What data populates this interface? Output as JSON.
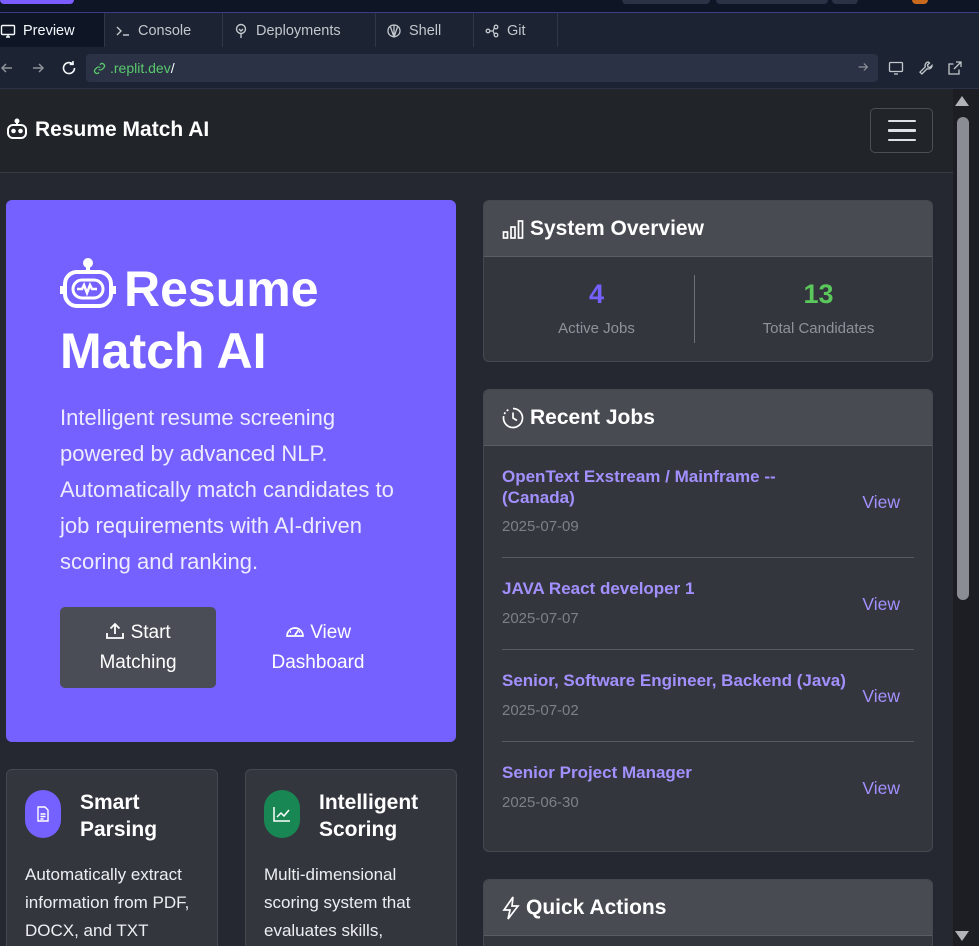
{
  "tabs": [
    {
      "label": "Preview",
      "icon": "monitor-icon"
    },
    {
      "label": "Console",
      "icon": "terminal-icon"
    },
    {
      "label": "Deployments",
      "icon": "deploy-icon"
    },
    {
      "label": "Shell",
      "icon": "shell-icon"
    },
    {
      "label": "Git",
      "icon": "git-icon"
    }
  ],
  "url": {
    "host": ".replit.dev",
    "path": "/"
  },
  "navbar": {
    "brand": "Resume Match AI"
  },
  "hero": {
    "title": "Resume Match AI",
    "description": "Intelligent resume screening powered by advanced NLP. Automatically match candidates to job requirements with AI-driven scoring and ranking.",
    "start_line1": "Start",
    "start_line2": "Matching",
    "dash_line1": "View",
    "dash_line2": "Dashboard"
  },
  "features": [
    {
      "title_line1": "Smart",
      "title_line2": "Parsing",
      "description": "Automatically extract information from PDF, DOCX, and TXT",
      "color": "#7461ff"
    },
    {
      "title_line1": "Intelligent",
      "title_line2": "Scoring",
      "description": "Multi-dimensional scoring system that evaluates skills,",
      "color": "#198754"
    }
  ],
  "overview": {
    "title": "System Overview",
    "active_jobs": "4",
    "active_jobs_label": "Active Jobs",
    "total_candidates": "13",
    "total_candidates_label": "Total Candidates"
  },
  "recent_jobs": {
    "title": "Recent Jobs",
    "view_label": "View",
    "items": [
      {
        "title": "OpenText Exstream / Mainframe -- (Canada)",
        "date": "2025-07-09"
      },
      {
        "title": "JAVA React developer 1",
        "date": "2025-07-07"
      },
      {
        "title": "Senior, Software Engineer, Backend (Java)",
        "date": "2025-07-02"
      },
      {
        "title": "Senior Project Manager",
        "date": "2025-06-30"
      }
    ]
  },
  "quick_actions": {
    "title": "Quick Actions"
  },
  "colors": {
    "accent": "#7461ff",
    "success": "#5ac85a",
    "link": "#a390ff"
  }
}
